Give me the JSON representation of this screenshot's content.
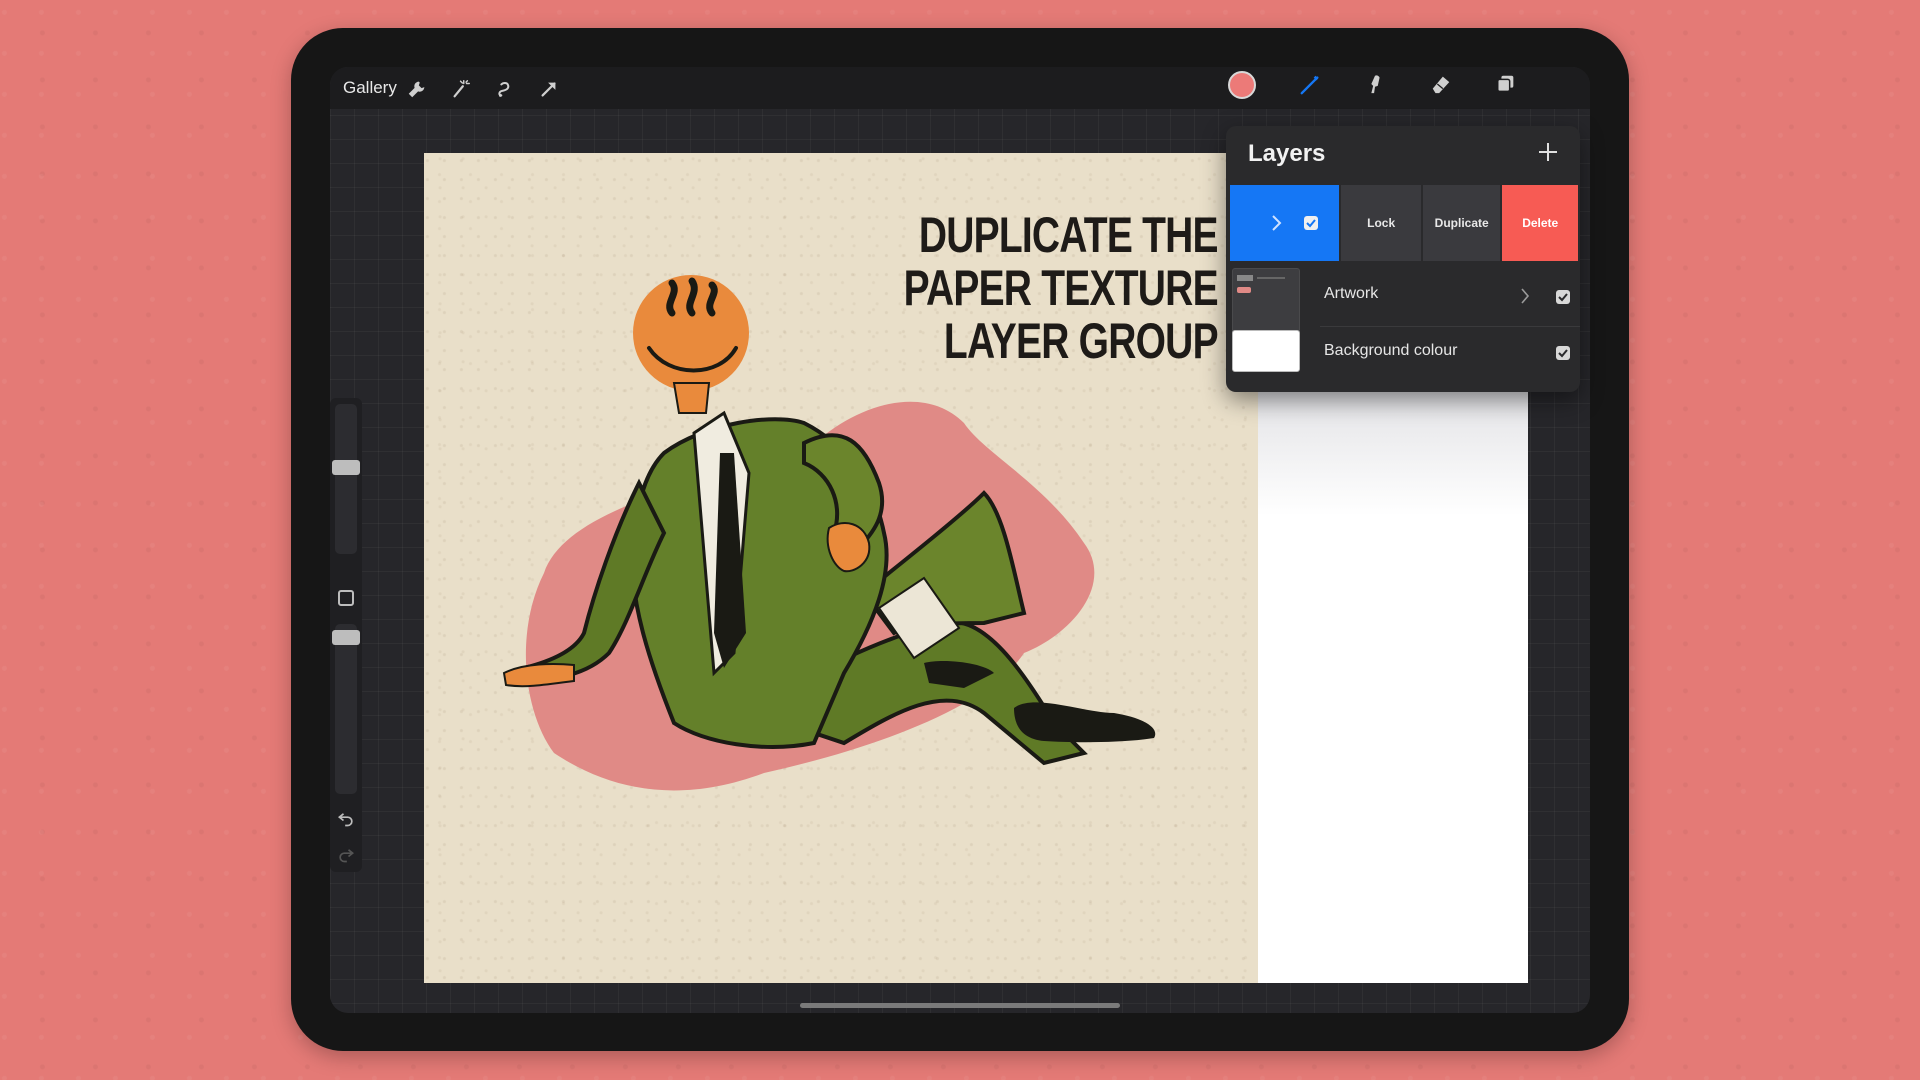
{
  "toolbar": {
    "gallery_label": "Gallery",
    "left_tools": [
      "wrench-icon",
      "magic-wand-icon",
      "selection-icon",
      "transform-icon"
    ],
    "right_tools": [
      "brush-icon",
      "smudge-icon",
      "eraser-icon",
      "layers-icon"
    ],
    "brush_active_color": "#1577f5",
    "current_color": "#ec7a78"
  },
  "canvas": {
    "headline_line1": "DUPLICATE THE",
    "headline_line2": "PAPER TEXTURE",
    "headline_line3": "LAYER GROUP"
  },
  "layers_panel": {
    "title": "Layers",
    "add_icon": "plus-icon",
    "swipe_actions": {
      "lock": "Lock",
      "duplicate": "Duplicate",
      "delete": "Delete"
    },
    "layers": [
      {
        "name": "Artwork",
        "visible": true,
        "is_group": true
      },
      {
        "name": "Background colour",
        "visible": true,
        "is_group": false
      }
    ],
    "selected_color": "#1577f5",
    "delete_color": "#f75b54"
  },
  "sidebar": {
    "icons": [
      "brush-size-slider",
      "modify-button",
      "opacity-slider",
      "undo-icon",
      "redo-icon"
    ]
  }
}
